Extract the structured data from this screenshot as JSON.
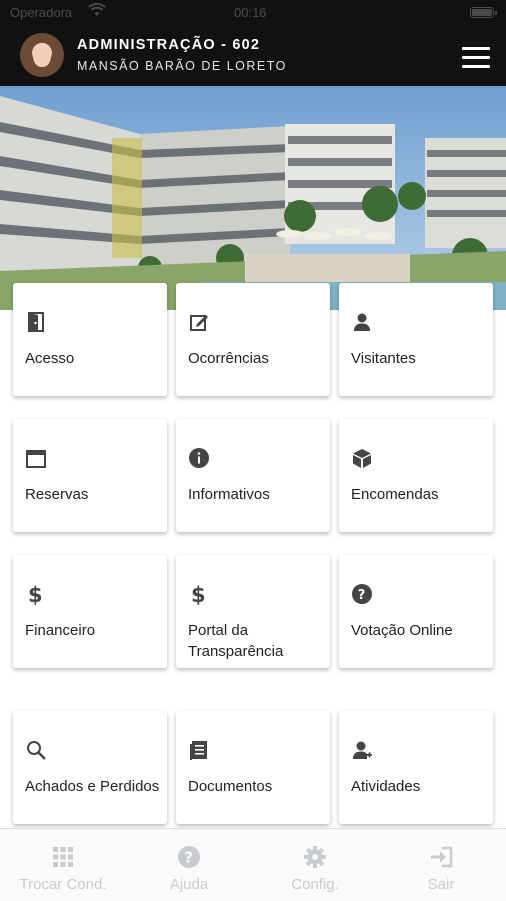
{
  "status_bar": {
    "carrier": "Operadora",
    "time": "00:16"
  },
  "header": {
    "title": "ADMINISTRAÇÃO - 602",
    "subtitle": "MANSÃO BARÃO DE LORETO"
  },
  "tiles": [
    {
      "label": "Acesso",
      "icon": "door-icon"
    },
    {
      "label": "Ocorrências",
      "icon": "edit-icon"
    },
    {
      "label": "Visitantes",
      "icon": "person-icon"
    },
    {
      "label": "Reservas",
      "icon": "calendar-icon"
    },
    {
      "label": "Informativos",
      "icon": "info-icon"
    },
    {
      "label": "Encomendas",
      "icon": "package-icon"
    },
    {
      "label": "Financeiro",
      "icon": "dollar-icon"
    },
    {
      "label": "Portal da Transparência",
      "icon": "dollar-icon"
    },
    {
      "label": "Votação Online",
      "icon": "help-icon"
    },
    {
      "label": "Achados e Perdidos",
      "icon": "search-icon"
    },
    {
      "label": "Documentos",
      "icon": "document-icon"
    },
    {
      "label": "Atividades",
      "icon": "person-plus-icon"
    }
  ],
  "tabbar": [
    {
      "label": "Trocar Cond.",
      "icon": "grid-icon"
    },
    {
      "label": "Ajuda",
      "icon": "help-icon"
    },
    {
      "label": "Config.",
      "icon": "gear-icon"
    },
    {
      "label": "Sair",
      "icon": "logout-icon"
    }
  ],
  "colors": {
    "header_bg": "#111111",
    "tab_inactive": "#c8ccd0",
    "icon": "#444444"
  }
}
